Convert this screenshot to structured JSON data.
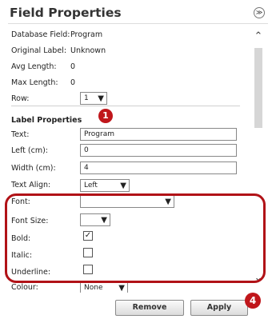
{
  "header": {
    "title": "Field Properties",
    "collapse_glyph": "❯❯"
  },
  "info": [
    {
      "label": "Database Field:",
      "value": "Program"
    },
    {
      "label": "Original Label:",
      "value": "Unknown"
    },
    {
      "label": "Avg Length:",
      "value": "0"
    },
    {
      "label": "Max Length:",
      "value": "0"
    }
  ],
  "row": {
    "label": "Row:",
    "value": "1"
  },
  "label_properties": {
    "title": "Label Properties",
    "text_label": "Text:",
    "text_value": "Program",
    "left_label": "Left (cm):",
    "left_value": "0",
    "width_label": "Width (cm):",
    "width_value": "4",
    "align_label": "Text Align:",
    "align_value": "Left"
  },
  "font_section": {
    "font_label": "Font:",
    "font_value": "",
    "size_label": "Font Size:",
    "size_value": "",
    "bold_label": "Bold:",
    "bold_checked": true,
    "italic_label": "Italic:",
    "underline_label": "Underline:",
    "colour_label": "Colour:",
    "colour_value": "None"
  },
  "badges": {
    "one": "1",
    "four": "4"
  },
  "footer": {
    "remove_label": "Remove",
    "apply_label": "Apply"
  },
  "colors": {
    "accent_red": "#b11217",
    "badge_red": "#c0161b"
  }
}
